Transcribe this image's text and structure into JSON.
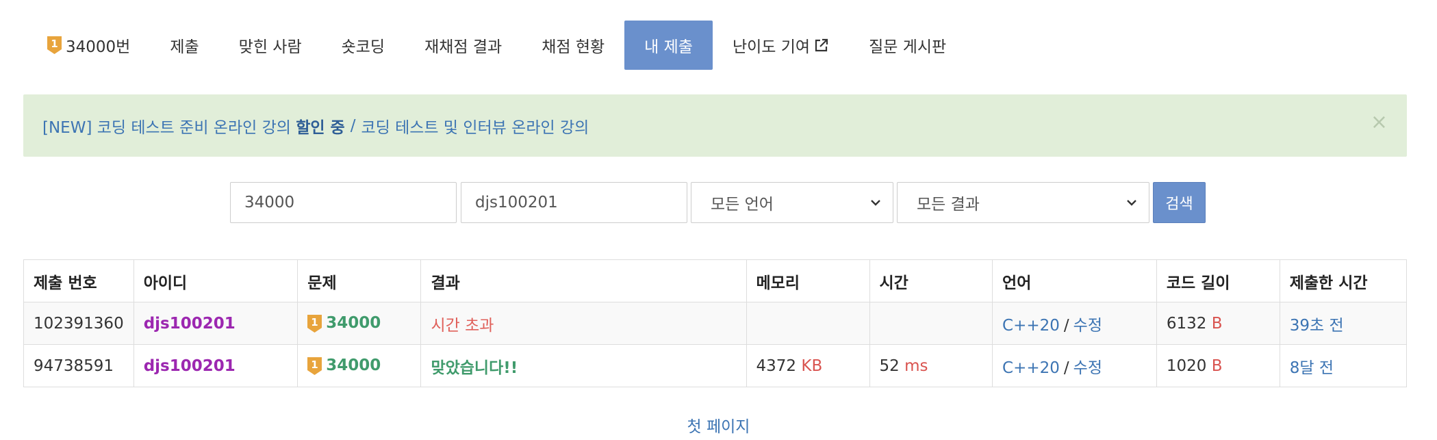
{
  "tabs": [
    {
      "label": "34000번",
      "tier": "1",
      "active": false
    },
    {
      "label": "제출",
      "active": false
    },
    {
      "label": "맞힌 사람",
      "active": false
    },
    {
      "label": "숏코딩",
      "active": false
    },
    {
      "label": "재채점 결과",
      "active": false
    },
    {
      "label": "채점 현황",
      "active": false
    },
    {
      "label": "내 제출",
      "active": true
    },
    {
      "label": "난이도 기여",
      "active": false
    },
    {
      "label": "질문 게시판",
      "active": false
    }
  ],
  "alert": {
    "link1_prefix": "[NEW] 코딩 테스트 준비 온라인 강의",
    "link1_bold": "할인 중",
    "separator": "/",
    "link2": "코딩 테스트 및 인터뷰 온라인 강의",
    "close": "×"
  },
  "form": {
    "problem_value": "34000",
    "user_value": "djs100201",
    "language_selected": "모든 언어",
    "result_selected": "모든 결과",
    "search_label": "검색"
  },
  "table": {
    "headers": [
      "제출 번호",
      "아이디",
      "문제",
      "결과",
      "메모리",
      "시간",
      "언어",
      "코드 길이",
      "제출한 시간"
    ],
    "rows": [
      {
        "id": "102391360",
        "user": "djs100201",
        "tier": "1",
        "problem": "34000",
        "result": "시간 초과",
        "memory": "",
        "memory_unit": "",
        "time": "",
        "time_unit": "",
        "language": "C++20",
        "edit": "수정",
        "length": "6132",
        "length_unit": "B",
        "submitted": "39초 전"
      },
      {
        "id": "94738591",
        "user": "djs100201",
        "tier": "1",
        "problem": "34000",
        "result": "맞았습니다!!",
        "memory": "4372",
        "memory_unit": "KB",
        "time": "52",
        "time_unit": "ms",
        "language": "C++20",
        "edit": "수정",
        "length": "1020",
        "length_unit": "B",
        "submitted": "8달 전"
      }
    ]
  },
  "pagination": {
    "first_page": "첫 페이지"
  },
  "colors": {
    "accent": "#6a90cc",
    "alert_bg": "#e1eed9",
    "tier_gold": "#e8a43c",
    "user": "#9c27b0",
    "accepted": "#409b6c",
    "tle": "#e0605a"
  }
}
